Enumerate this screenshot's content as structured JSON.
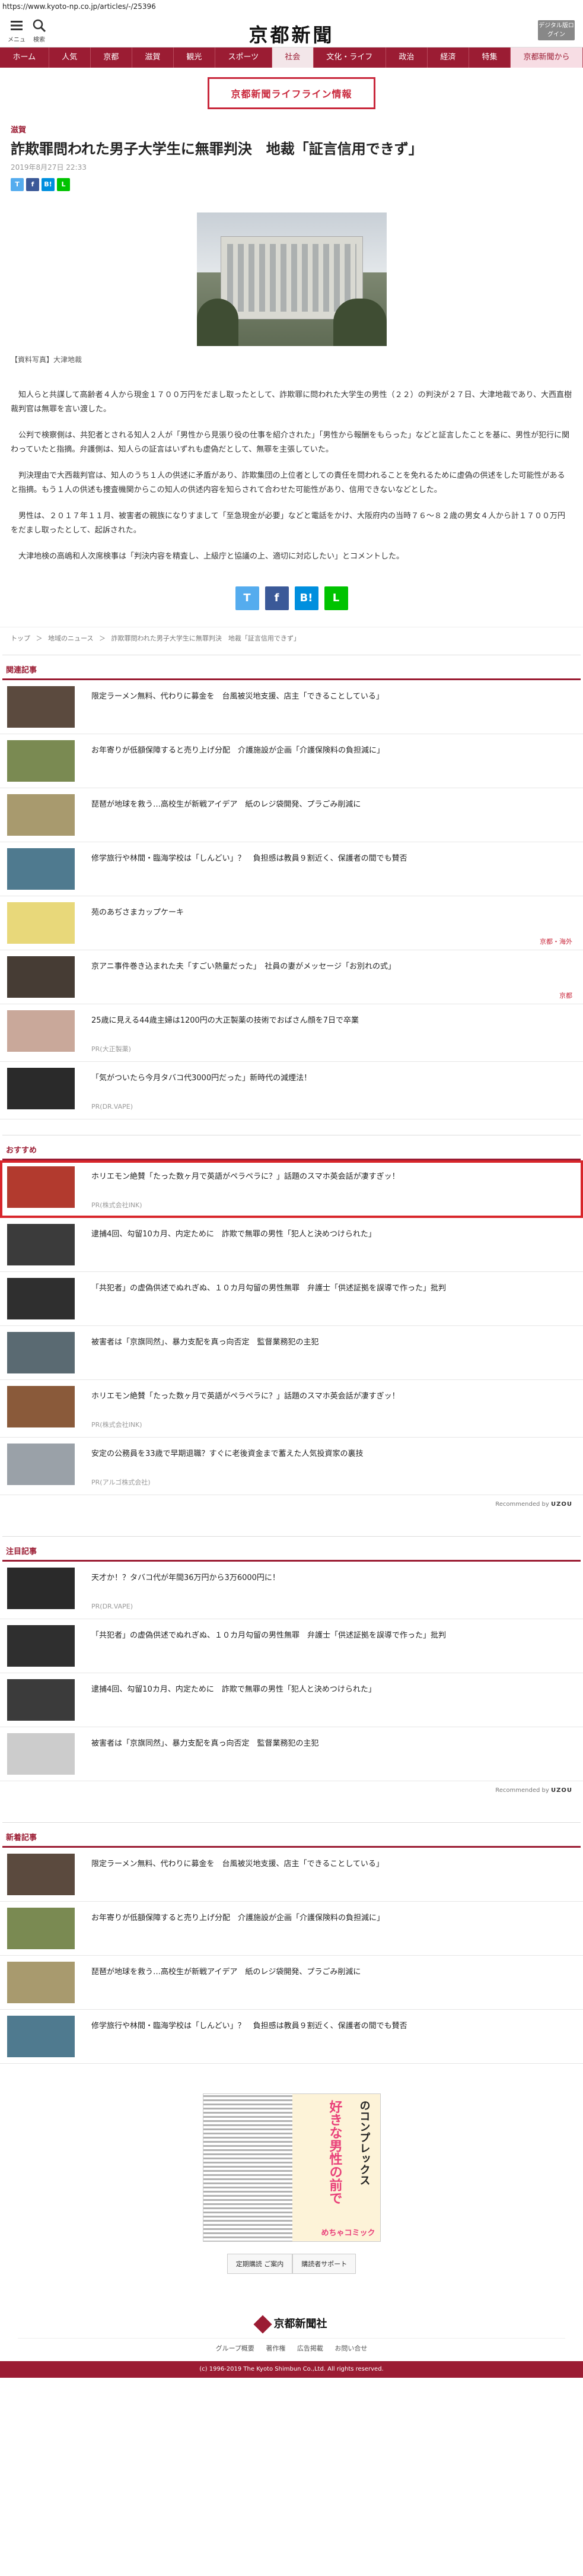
{
  "browser": {
    "url": "https://www.kyoto-np.co.jp/articles/-/25396"
  },
  "header": {
    "menu_label": "メニュー",
    "search_label": "検索",
    "logo": "京都新聞",
    "digital_label": "デジタル版ログイン"
  },
  "nav": {
    "items": [
      "ホーム",
      "人気",
      "京都",
      "滋賀",
      "観光",
      "スポーツ",
      "社会",
      "文化・ライフ",
      "政治",
      "経済",
      "特集",
      "京都新聞から"
    ],
    "active_index": 6
  },
  "banner": {
    "label": "京都新聞ライフライン情報"
  },
  "article": {
    "section": "滋賀",
    "title": "詐欺罪問われた男子大学生に無罪判決　地裁「証言信用できず」",
    "date": "2019年8月27日 22:33",
    "share_small": [
      "T",
      "f",
      "B!",
      "L"
    ],
    "photo_caption": "【資料写真】大津地裁",
    "paragraphs": [
      "知人らと共謀して高齢者４人から現金１７００万円をだまし取ったとして、詐欺罪に問われた大学生の男性（２２）の判決が２７日、大津地裁であり、大西直樹裁判官は無罪を言い渡した。",
      "公判で検察側は、共犯者とされる知人２人が「男性から見張り役の仕事を紹介された」「男性から報酬をもらった」などと証言したことを基に、男性が犯行に関わっていたと指摘。弁護側は、知人らの証言はいずれも虚偽だとして、無罪を主張していた。",
      "判決理由で大西裁判官は、知人のうち１人の供述に矛盾があり、詐欺集団の上位者としての責任を問われることを免れるために虚偽の供述をした可能性があると指摘。もう１人の供述も捜査機関からこの知人の供述内容を知らされて合わせた可能性があり、信用できないなどとした。",
      "男性は、２０１７年１１月、被害者の親族になりすまして「至急現金が必要」などと電話をかけ、大阪府内の当時７６〜８２歳の男女４人から計１７００万円をだまし取ったとして、起訴された。",
      "大津地検の高嶋和人次席検事は「判決内容を精査し、上級庁と協議の上、適切に対応したい」とコメントした。"
    ],
    "share_big": [
      "T",
      "f",
      "B!",
      "L"
    ]
  },
  "breadcrumb": [
    "トップ",
    "＞",
    "地域のニュース",
    "＞",
    "詐欺罪問われた男子大学生に無罪判決　地裁「証言信用できず」"
  ],
  "related": {
    "header": "関連記事",
    "items": [
      {
        "text": "限定ラーメン無料、代わりに募金を　台風被災地支援、店主「できることしている」",
        "tag": "",
        "pr": "",
        "thumb": "#5b4a3e"
      },
      {
        "text": "お年寄りが低額保障すると売り上げ分配　介護施設が企画「介護保険料の負担減に」",
        "tag": "",
        "pr": "",
        "thumb": "#7a8a52"
      },
      {
        "text": "琵琶が地球を救う…高校生が新戦アイデア　紙のレジ袋開発、プラごみ削減に",
        "tag": "",
        "pr": "",
        "thumb": "#a89a6e"
      },
      {
        "text": "修学旅行や林間・臨海学校は「しんどい」？　負担感は教員９割近く、保護者の間でも賛否",
        "tag": "",
        "pr": "",
        "thumb": "#4f7a8f"
      },
      {
        "text": "苑のあぢさまカップケーキ",
        "tag": "京都・海外",
        "pr": "",
        "thumb": "#e8d87a"
      },
      {
        "text": "京アニ事件巻き込まれた夫「すごい熱量だった」　社員の妻がメッセージ「お別れの式」",
        "tag": "京都",
        "pr": "",
        "thumb": "#463c34"
      },
      {
        "text": "25歳に見える44歳主婦は1200円の大正製薬の技術でおばさん顔を7日で卒業",
        "tag": "",
        "pr": "PR(大正製薬)",
        "thumb": "#c9a89a"
      },
      {
        "text": "「気がついたら今月タバコ代3000円だった」新時代の減煙法！",
        "tag": "",
        "pr": "PR(DR.VAPE)",
        "thumb": "#2a2a2a"
      }
    ]
  },
  "recommend": {
    "header": "おすすめ",
    "items": [
      {
        "text": "ホリエモン絶賛「たった数ヶ月で英語がペラペラに？」話題のスマホ英会話が凄すぎッ！",
        "pr": "PR(株式会社INK)",
        "thumb": "#b23a2e",
        "highlight": true
      },
      {
        "text": "逮捕4回、勾留10カ月、内定ために　詐欺で無罪の男性「犯人と決めつけられた」",
        "pr": "",
        "thumb": "#3b3b3b",
        "highlight": false
      },
      {
        "text": "「共犯者」の虚偽供述でぬれぎぬ、１０カ月勾留の男性無罪　弁護士「供述証拠を誤導で作った」批判",
        "pr": "",
        "thumb": "#2f2f2f",
        "highlight": false
      },
      {
        "text": "被害者は「京旗同然」、暴力支配を真っ向否定　監督業務犯の主犯",
        "pr": "",
        "thumb": "#5a6a72",
        "highlight": false
      },
      {
        "text": "ホリエモン絶賛「たった数ヶ月で英語がペラペラに？」話題のスマホ英会話が凄すぎッ！",
        "pr": "PR(株式会社INK)",
        "thumb": "#8a5a3a",
        "highlight": false
      },
      {
        "text": "安定の公務員を33歳で早期退職？すぐに老後資金まで蓄えた人気投資家の裏技",
        "pr": "PR(アルゴ株式会社)",
        "thumb": "#9aa1a8",
        "highlight": false
      }
    ],
    "credit_prefix": "Recommended by",
    "credit_brand": "UZOU"
  },
  "notable": {
    "header": "注目記事",
    "items": [
      {
        "text": "天才か！？タバコ代が年間36万円から3万6000円に！",
        "pr": "PR(DR.VAPE)",
        "thumb": "#2a2a2a"
      },
      {
        "text": "「共犯者」の虚偽供述でぬれぎぬ、１０カ月勾留の男性無罪　弁護士「供述証拠を誤導で作った」批判",
        "pr": "",
        "thumb": "#2f2f2f"
      },
      {
        "text": "逮捕4回、勾留10カ月、内定ために　詐欺で無罪の男性「犯人と決めつけられた」",
        "pr": "",
        "thumb": "#3b3b3b"
      },
      {
        "text": "被害者は「京旗同然」、暴力支配を真っ向否定　監督業務犯の主犯",
        "pr": "",
        "thumb": "#ccc"
      }
    ],
    "credit_prefix": "Recommended by",
    "credit_brand": "UZOU"
  },
  "latest": {
    "header": "新着記事",
    "items": [
      {
        "text": "限定ラーメン無料、代わりに募金を　台風被災地支援、店主「できることしている」",
        "thumb": "#5b4a3e"
      },
      {
        "text": "お年寄りが低額保障すると売り上げ分配　介護施設が企画「介護保険料の負担減に」",
        "thumb": "#7a8a52"
      },
      {
        "text": "琵琶が地球を救う…高校生が新戦アイデア　紙のレジ袋開発、プラごみ削減に",
        "thumb": "#a89a6e"
      },
      {
        "text": "修学旅行や林間・臨海学校は「しんどい」？　負担感は教員９割近く、保護者の間でも賛否",
        "thumb": "#4f7a8f"
      }
    ]
  },
  "ad": {
    "text_pink": "好きな男性の前で",
    "text_black": "のコンプレックス",
    "brand": "めちゃコミック"
  },
  "footer_links_box": [
    "定期購読 ご案内",
    "購読者サポート"
  ],
  "footer": {
    "company": "京都新聞社",
    "links": [
      "グループ概要",
      "著作権",
      "広告掲載",
      "お問い合せ"
    ],
    "copyright": "(c) 1996-2019 The Kyoto Shimbun Co.,Ltd. All rights reserved."
  },
  "colors": {
    "brand": "#9b1c33",
    "accent": "#c9283c",
    "twitter": "#55acee",
    "facebook": "#3b5998",
    "hatena": "#008fde",
    "line": "#00c300"
  }
}
